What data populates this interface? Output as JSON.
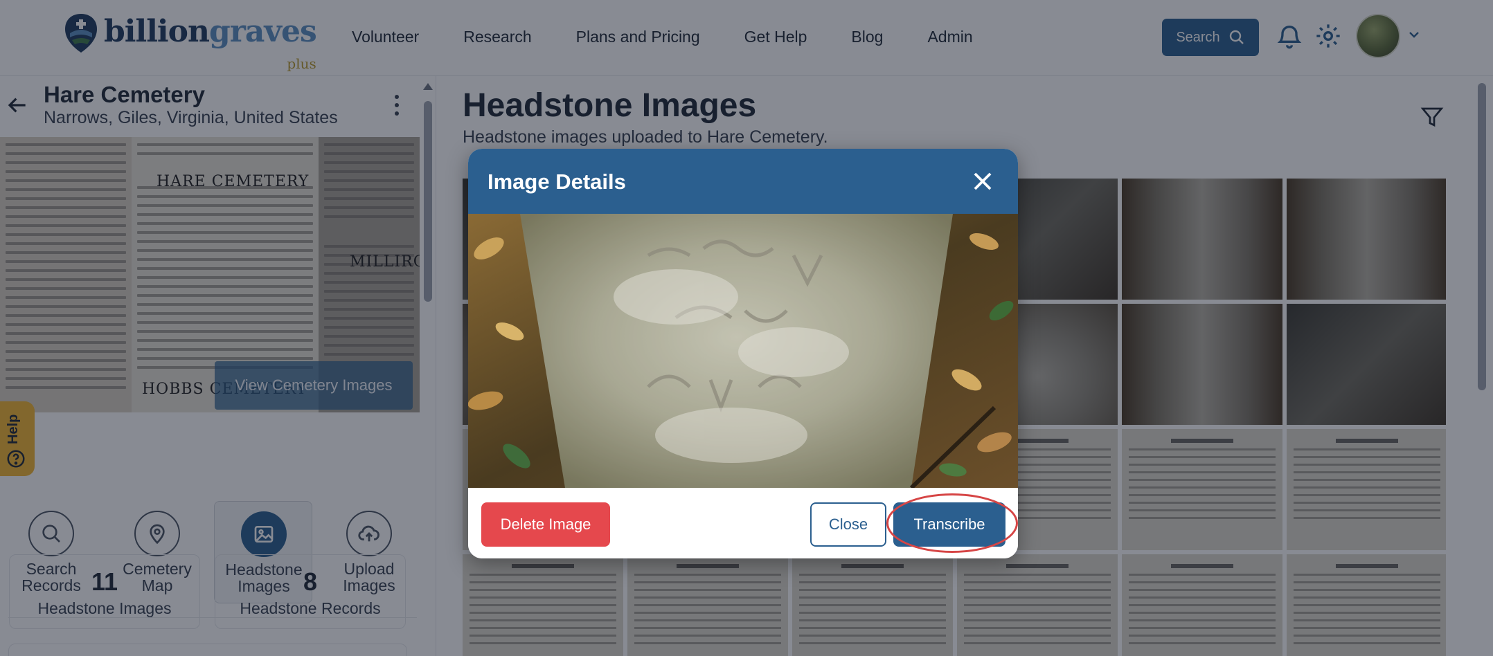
{
  "brand": {
    "name_part1": "billion",
    "name_part2": "graves",
    "tier": "plus"
  },
  "nav": {
    "items": [
      "Volunteer",
      "Research",
      "Plans and Pricing",
      "Get Help",
      "Blog",
      "Admin"
    ]
  },
  "header": {
    "search_label": "Search"
  },
  "cemetery": {
    "name": "Hare Cemetery",
    "location": "Narrows, Giles, Virginia, United States",
    "photo_heading_1": "HARE CEMETERY",
    "photo_heading_2": "HOBBS CEMETERY",
    "photo_heading_3": "MILLIRON",
    "view_images_label": "View Cemetery Images"
  },
  "help": {
    "label": "Help"
  },
  "quick_actions": [
    {
      "label": "Search\nRecords",
      "icon": "search-icon",
      "active": false
    },
    {
      "label": "Cemetery\nMap",
      "icon": "map-pin-icon",
      "active": false
    },
    {
      "label": "Headstone\nImages",
      "icon": "image-icon",
      "active": true
    },
    {
      "label": "Upload\nImages",
      "icon": "cloud-upload-icon",
      "active": false
    }
  ],
  "stats": [
    {
      "value": "11",
      "label": "Headstone Images"
    },
    {
      "value": "8",
      "label": "Headstone Records"
    }
  ],
  "main": {
    "title": "Headstone Images",
    "subtitle": "Headstone images uploaded to Hare Cemetery."
  },
  "modal": {
    "title": "Image Details",
    "delete_label": "Delete Image",
    "close_label": "Close",
    "transcribe_label": "Transcribe"
  },
  "colors": {
    "brand_blue": "#2b5f8f",
    "danger_red": "#e5484d",
    "help_yellow": "#f2b632",
    "annotation_ring": "#d64545"
  }
}
